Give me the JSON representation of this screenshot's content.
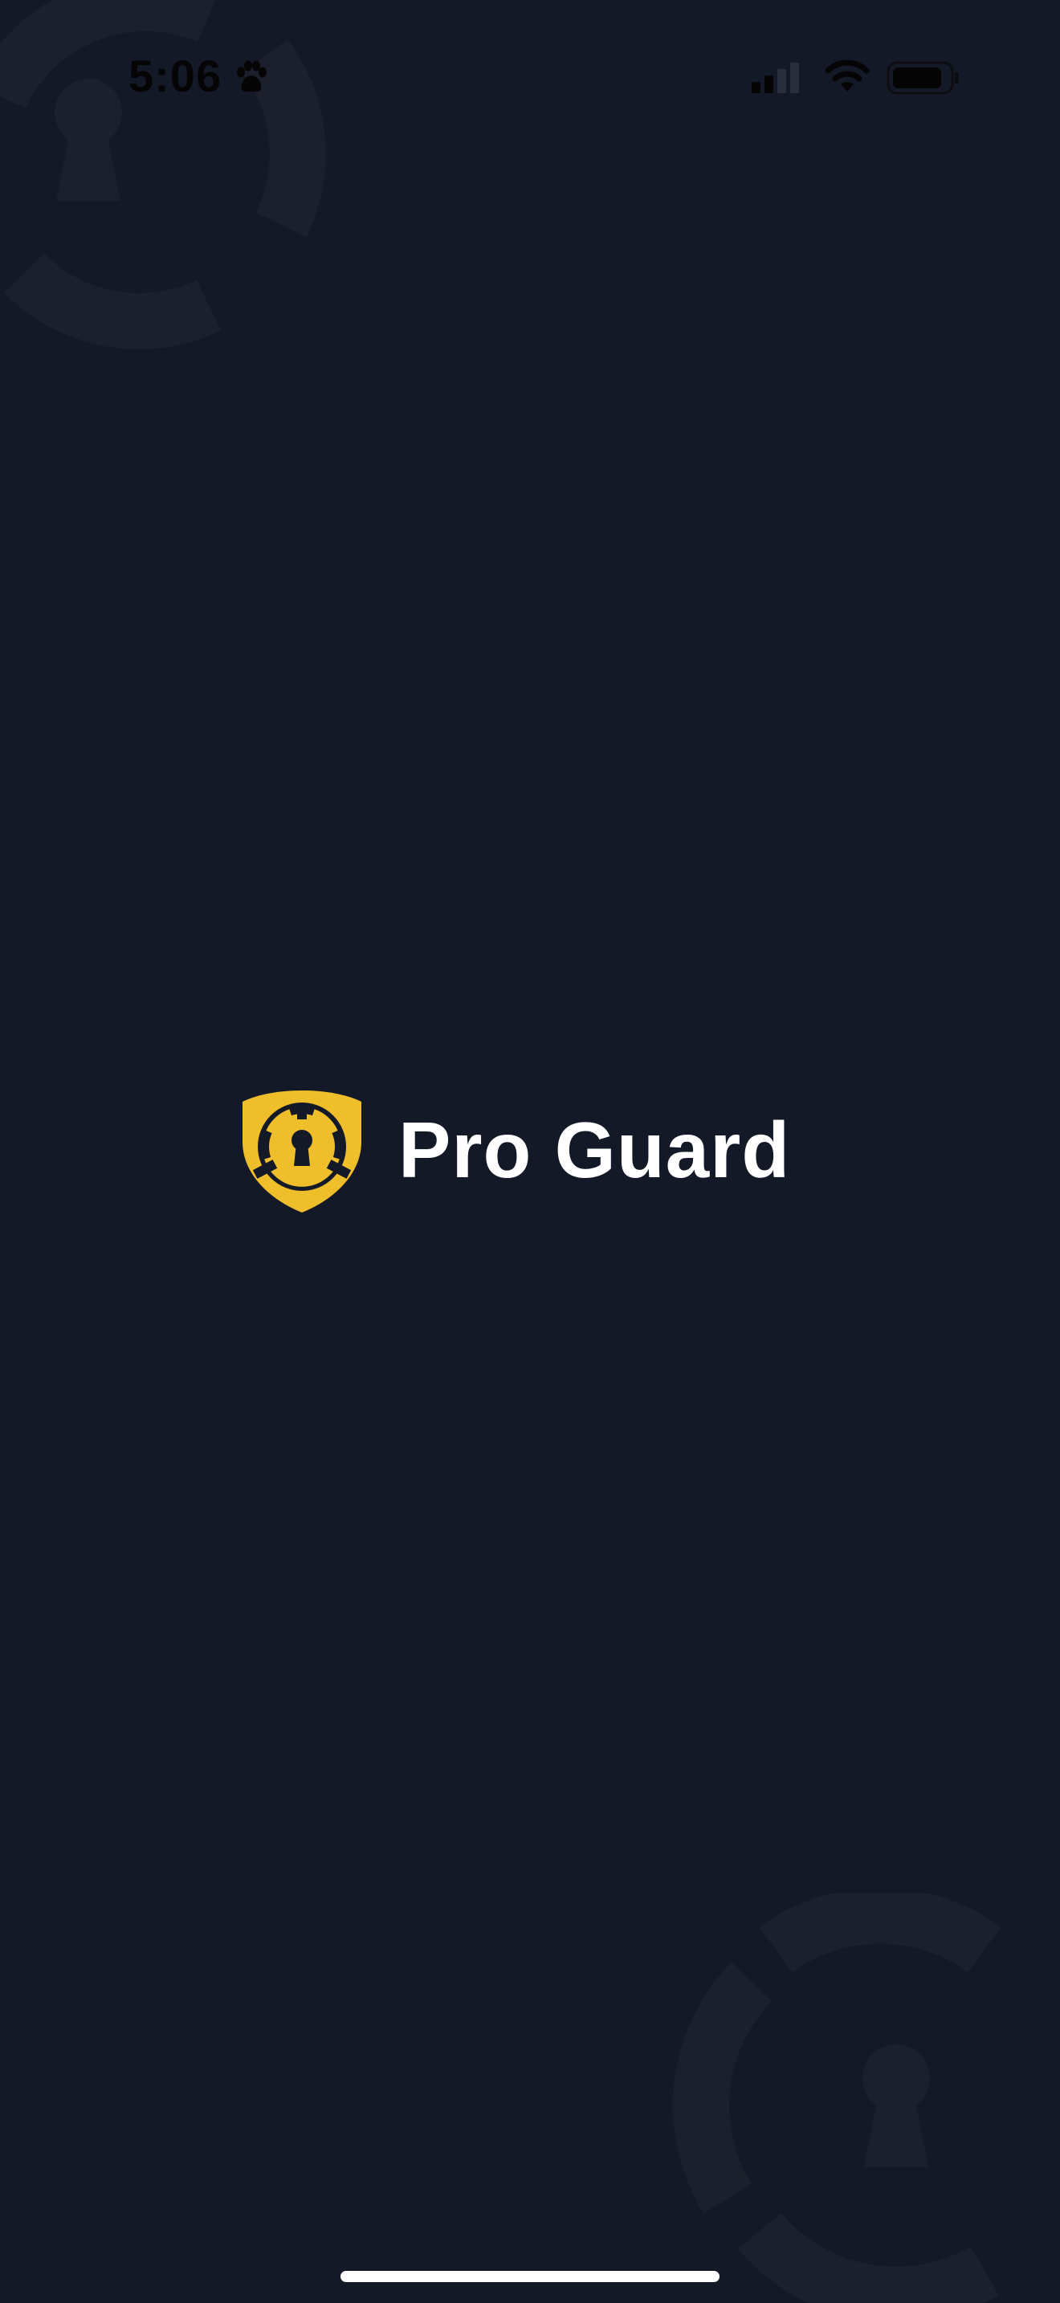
{
  "status_bar": {
    "time": "5:06",
    "icons": [
      "paw-icon",
      "cellular-signal-icon",
      "wifi-icon",
      "battery-icon"
    ]
  },
  "splash": {
    "app_name": "Pro Guard",
    "logo_icon": "shield-keyhole-icon"
  },
  "colors": {
    "background": "#141927",
    "accent": "#EFBE2B",
    "watermark": "#1C202C",
    "text_primary": "#FFFFFF",
    "status_text": "#050505"
  }
}
